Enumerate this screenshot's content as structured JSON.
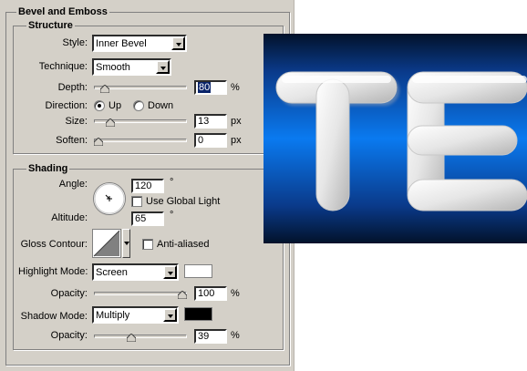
{
  "panel": {
    "title": "Bevel and Emboss",
    "structure": {
      "legend": "Structure",
      "style_label": "Style:",
      "style_value": "Inner Bevel",
      "technique_label": "Technique:",
      "technique_value": "Smooth",
      "depth_label": "Depth:",
      "depth_value": "80",
      "depth_unit": "%",
      "depth_level": 0.08,
      "direction_label": "Direction:",
      "direction_up": "Up",
      "direction_down": "Down",
      "direction_selected": "Up",
      "size_label": "Size:",
      "size_value": "13",
      "size_unit": "px",
      "size_level": 0.14,
      "soften_label": "Soften:",
      "soften_value": "0",
      "soften_unit": "px",
      "soften_level": 0.0
    },
    "shading": {
      "legend": "Shading",
      "angle_label": "Angle:",
      "angle_value": "120",
      "angle_unit": "°",
      "use_global_light_label": "Use Global Light",
      "use_global_light_checked": false,
      "altitude_label": "Altitude:",
      "altitude_value": "65",
      "altitude_unit": "°",
      "gloss_contour_label": "Gloss Contour:",
      "anti_aliased_label": "Anti-aliased",
      "anti_aliased_checked": false,
      "highlight_mode_label": "Highlight Mode:",
      "highlight_mode_value": "Screen",
      "highlight_color": "#ffffff",
      "highlight_opacity_label": "Opacity:",
      "highlight_opacity_value": "100",
      "highlight_opacity_unit": "%",
      "highlight_opacity_level": 1.0,
      "shadow_mode_label": "Shadow Mode:",
      "shadow_mode_value": "Multiply",
      "shadow_color": "#000000",
      "shadow_opacity_label": "Opacity:",
      "shadow_opacity_value": "39",
      "shadow_opacity_unit": "%",
      "shadow_opacity_level": 0.39
    }
  },
  "preview": {
    "text": "TE",
    "bg_center": "#0a7af0",
    "bg_edge": "#031a3a"
  }
}
